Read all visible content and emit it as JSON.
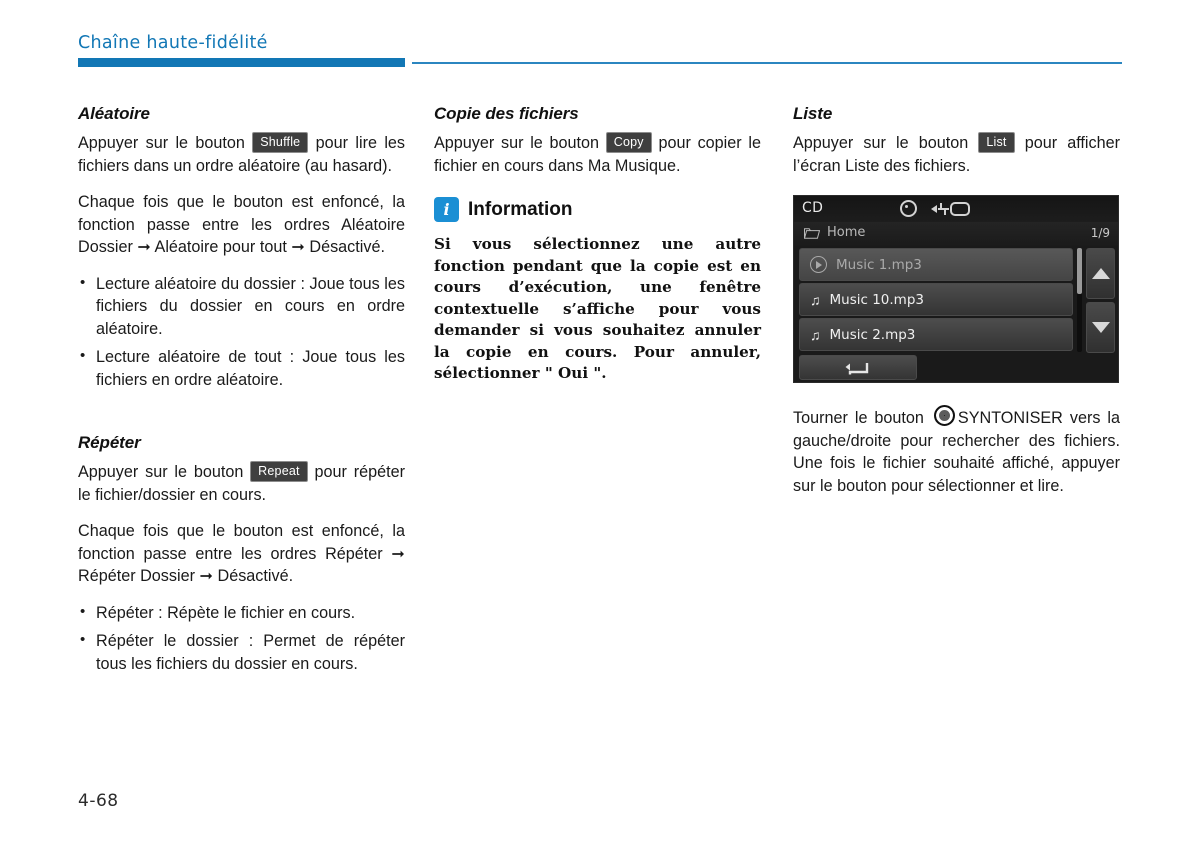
{
  "header": {
    "title": "Chaîne haute-fidélité",
    "accent_color": "#1277b5"
  },
  "footer": {
    "page_number": "4-68"
  },
  "column_1": {
    "shuffle": {
      "title": "Aléatoire",
      "para_1_before": "Appuyer sur le bouton",
      "badge": "Shuffle",
      "para_1_after": "pour lire les fichiers dans un ordre aléatoire (au hasard).",
      "para_2": "Chaque fois que le bouton est enfoncé, la fonction passe entre les ordres Aléatoire Dossier ➞ Aléatoire pour tout ➞ Désactivé.",
      "bullets": [
        "Lecture aléatoire du dossier : Joue tous les fichiers du dossier en cours en ordre aléatoire.",
        "Lecture aléatoire de tout : Joue tous les fichiers en ordre aléatoire."
      ]
    },
    "repeat": {
      "title": "Répéter",
      "para_1_before": "Appuyer sur le bouton",
      "badge": "Repeat",
      "para_1_after": "pour répéter le fichier/dossier en cours.",
      "para_2": "Chaque fois que le bouton est enfoncé, la fonction passe entre les ordres Répéter ➞ Répéter Dossier ➞ Désactivé.",
      "bullets": [
        "Répéter : Répète le fichier en cours.",
        "Répéter le dossier : Permet de répéter tous les fichiers du dossier en cours."
      ]
    }
  },
  "column_2": {
    "copy": {
      "title": "Copie des fichiers",
      "para_1_before": "Appuyer sur le bouton",
      "badge": "Copy",
      "para_1_after": "pour copier le fichier en cours dans Ma Musique."
    },
    "information": {
      "icon": "info-icon",
      "title": "Information",
      "text": "Si vous sélectionnez une autre fonction pendant que la copie est en cours d’exécution, une fenêtre contextuelle s’affiche pour vous demander si vous souhaitez annuler la copie en cours. Pour annuler, sélectionner \" Oui \"."
    }
  },
  "column_3": {
    "list": {
      "title": "Liste",
      "para_1_before": "Appuyer sur le bouton",
      "badge": "List",
      "para_1_after": "pour afficher l’écran Liste des fichiers."
    },
    "screen": {
      "source_label": "CD",
      "status_icons": [
        "disc-icon",
        "usb-icon"
      ],
      "path_label": "Home",
      "page_count": "1/9",
      "rows": [
        {
          "label": "Music 1.mp3",
          "icon": "play-circle-icon",
          "state": "playing"
        },
        {
          "label": "Music 10.mp3",
          "icon": "music-note-icon",
          "state": "normal"
        },
        {
          "label": "Music 2.mp3",
          "icon": "music-note-icon",
          "state": "normal"
        }
      ],
      "scroll_up": "▲",
      "scroll_down": "▼",
      "back_button": "↰"
    },
    "tune": {
      "para_before": "Tourner le bouton",
      "knob_label": "SYNTONISER",
      "para_after": "vers la gauche/droite pour rechercher des fichiers. Une fois le fichier souhaité affiché, appuyer sur le bouton pour sélectionner et lire."
    }
  }
}
